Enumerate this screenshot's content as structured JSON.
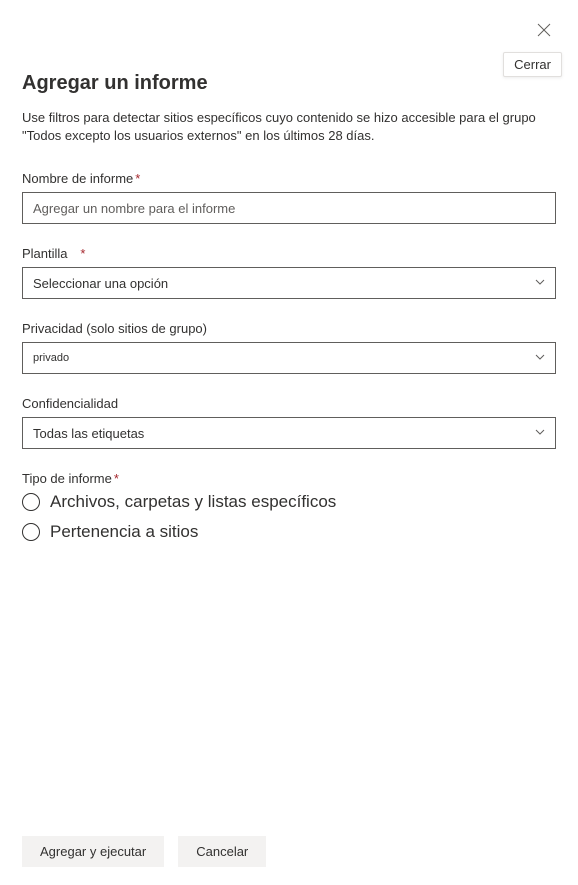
{
  "header": {
    "close_tooltip": "Cerrar"
  },
  "title": "Agregar un informe",
  "description": "Use filtros para detectar sitios específicos cuyo contenido se hizo accesible para el grupo \"Todos excepto los usuarios externos\" en los últimos 28 días.",
  "fields": {
    "report_name": {
      "label": "Nombre de informe",
      "required_mark": "*",
      "placeholder": "Agregar un nombre para el informe",
      "value": ""
    },
    "template": {
      "label": "Plantilla",
      "required_mark": "*",
      "selected": "Seleccionar una opción"
    },
    "privacy": {
      "label": "Privacidad (solo sitios de grupo)",
      "selected": "privado"
    },
    "sensitivity": {
      "label": "Confidencialidad",
      "selected": "Todas las etiquetas"
    },
    "report_type": {
      "label": "Tipo de informe",
      "required_mark": "*",
      "options": [
        "Archivos, carpetas y listas específicos",
        "Pertenencia a sitios"
      ]
    }
  },
  "footer": {
    "primary": "Agregar y ejecutar",
    "secondary": "Cancelar"
  }
}
